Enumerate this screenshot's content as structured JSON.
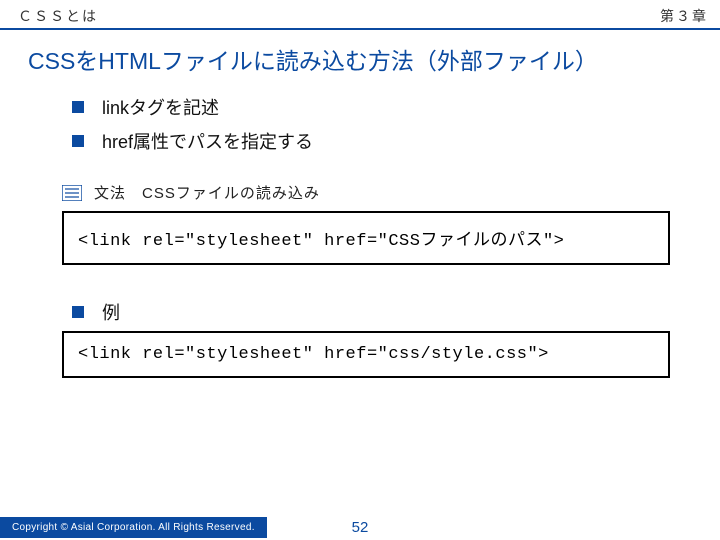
{
  "header": {
    "breadcrumb": "ＣＳＳとは",
    "chapter": "第３章"
  },
  "title": "CSSをHTMLファイルに読み込む方法（外部ファイル）",
  "bullets": [
    "linkタグを記述",
    "href属性でパスを指定する"
  ],
  "syntax": {
    "label": "文法　CSSファイルの読み込み",
    "code": "<link rel=\"stylesheet\" href=\"CSSファイルのパス\">"
  },
  "example": {
    "label": "例",
    "code": "<link rel=\"stylesheet\" href=\"css/style.css\">"
  },
  "footer": {
    "copyright": "Copyright ©  Asial Corporation. All Rights Reserved.",
    "page": "52"
  }
}
